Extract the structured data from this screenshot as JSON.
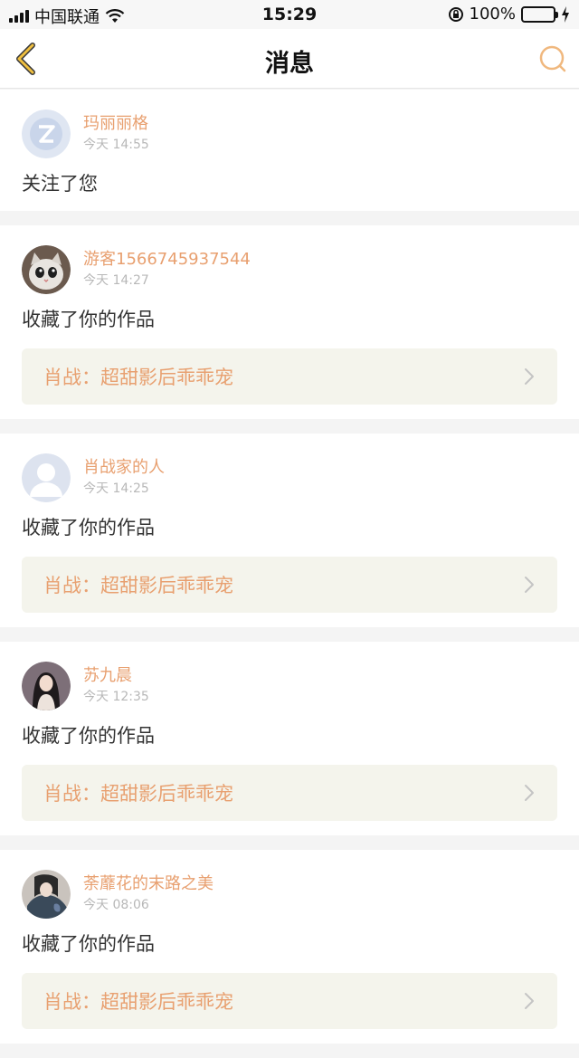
{
  "status_bar": {
    "carrier": "中国联通",
    "time": "15:29",
    "battery": "100%"
  },
  "nav": {
    "title": "消息",
    "back_icon": "chevron-left-icon",
    "search_icon": "search-icon",
    "accent": "#f0b87e"
  },
  "messages": [
    {
      "name": "玛丽丽格",
      "time": "今天 14:55",
      "action": "关注了您",
      "work": ""
    },
    {
      "name": "游客1566745937544",
      "time": "今天 14:27",
      "action": "收藏了你的作品",
      "work": "肖战：超甜影后乖乖宠"
    },
    {
      "name": "肖战家的人",
      "time": "今天 14:25",
      "action": "收藏了你的作品",
      "work": "肖战：超甜影后乖乖宠"
    },
    {
      "name": "苏九晨",
      "time": "今天 12:35",
      "action": "收藏了你的作品",
      "work": "肖战：超甜影后乖乖宠"
    },
    {
      "name": "荼蘼花的末路之美",
      "time": "今天 08:06",
      "action": "收藏了你的作品",
      "work": "肖战：超甜影后乖乖宠"
    }
  ]
}
